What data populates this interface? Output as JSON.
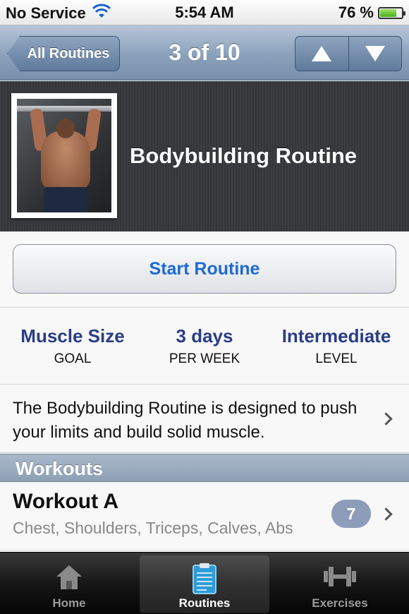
{
  "status_bar": {
    "carrier": "No Service",
    "time": "5:54 AM",
    "battery_percent": "76 %",
    "battery_level": 0.76,
    "wifi_icon": "wifi-icon",
    "battery_icon": "battery-icon"
  },
  "nav": {
    "back_label": "All Routines",
    "title": "3 of 10",
    "up_icon": "up-arrow-icon",
    "down_icon": "down-arrow-icon"
  },
  "routine": {
    "name": "Bodybuilding Routine",
    "photo": "bodybuilder-photo",
    "start_label": "Start Routine",
    "stats": [
      {
        "value": "Muscle Size",
        "label": "GOAL"
      },
      {
        "value": "3 days",
        "label": "PER WEEK"
      },
      {
        "value": "Intermediate",
        "label": "LEVEL"
      }
    ],
    "description": "The Bodybuilding Routine is designed to push your limits and build solid muscle."
  },
  "workouts_section": {
    "title": "Workouts",
    "items": [
      {
        "name": "Workout A",
        "muscles": "Chest, Shoulders, Triceps, Calves, Abs",
        "count": "7"
      }
    ]
  },
  "tab_bar": {
    "tabs": [
      {
        "label": "Home",
        "icon": "home-icon",
        "active": false
      },
      {
        "label": "Routines",
        "icon": "clipboard-icon",
        "active": true
      },
      {
        "label": "Exercises",
        "icon": "dumbbell-icon",
        "active": false
      }
    ]
  },
  "colors": {
    "accent_blue": "#1e6ad4",
    "stat_blue": "#2a3d86",
    "nav_bar": "#8aa1bb",
    "badge": "#8d9db9"
  }
}
